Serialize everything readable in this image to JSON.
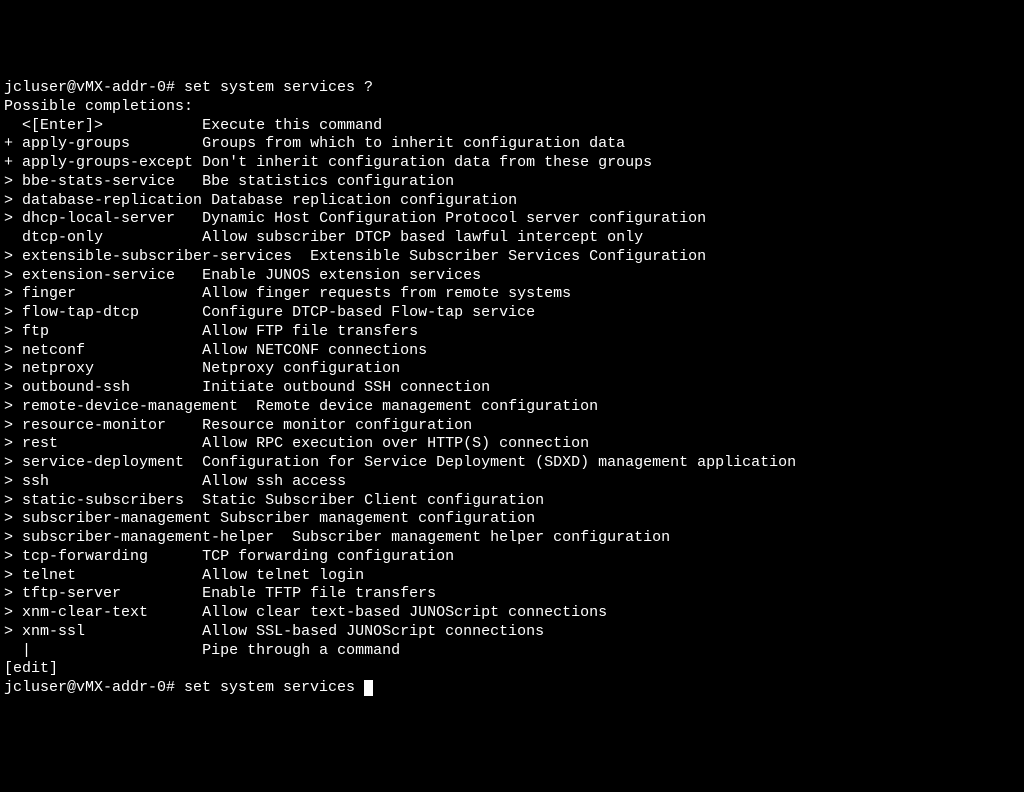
{
  "prompt_user": "jcluser@vMX-addr-0#",
  "prompt_command": "set system services ?",
  "header": "Possible completions:",
  "completions": [
    {
      "marker": " ",
      "cmd": "<[Enter]>",
      "pad": "           ",
      "desc": "Execute this command"
    },
    {
      "marker": "+",
      "cmd": "apply-groups",
      "pad": "        ",
      "desc": "Groups from which to inherit configuration data"
    },
    {
      "marker": "+",
      "cmd": "apply-groups-except",
      "pad": " ",
      "desc": "Don't inherit configuration data from these groups"
    },
    {
      "marker": ">",
      "cmd": "bbe-stats-service",
      "pad": "   ",
      "desc": "Bbe statistics configuration"
    },
    {
      "marker": ">",
      "cmd": "database-replication",
      "pad": " ",
      "desc": "Database replication configuration"
    },
    {
      "marker": ">",
      "cmd": "dhcp-local-server",
      "pad": "   ",
      "desc": "Dynamic Host Configuration Protocol server configuration"
    },
    {
      "marker": " ",
      "cmd": "dtcp-only",
      "pad": "           ",
      "desc": "Allow subscriber DTCP based lawful intercept only"
    },
    {
      "marker": ">",
      "cmd": "extensible-subscriber-services",
      "pad": "  ",
      "desc": "Extensible Subscriber Services Configuration"
    },
    {
      "marker": ">",
      "cmd": "extension-service",
      "pad": "   ",
      "desc": "Enable JUNOS extension services"
    },
    {
      "marker": ">",
      "cmd": "finger",
      "pad": "              ",
      "desc": "Allow finger requests from remote systems"
    },
    {
      "marker": ">",
      "cmd": "flow-tap-dtcp",
      "pad": "       ",
      "desc": "Configure DTCP-based Flow-tap service"
    },
    {
      "marker": ">",
      "cmd": "ftp",
      "pad": "                 ",
      "desc": "Allow FTP file transfers"
    },
    {
      "marker": ">",
      "cmd": "netconf",
      "pad": "             ",
      "desc": "Allow NETCONF connections"
    },
    {
      "marker": ">",
      "cmd": "netproxy",
      "pad": "            ",
      "desc": "Netproxy configuration"
    },
    {
      "marker": ">",
      "cmd": "outbound-ssh",
      "pad": "        ",
      "desc": "Initiate outbound SSH connection"
    },
    {
      "marker": ">",
      "cmd": "remote-device-management",
      "pad": "  ",
      "desc": "Remote device management configuration"
    },
    {
      "marker": ">",
      "cmd": "resource-monitor",
      "pad": "    ",
      "desc": "Resource monitor configuration"
    },
    {
      "marker": ">",
      "cmd": "rest",
      "pad": "                ",
      "desc": "Allow RPC execution over HTTP(S) connection"
    },
    {
      "marker": ">",
      "cmd": "service-deployment",
      "pad": "  ",
      "desc": "Configuration for Service Deployment (SDXD) management application"
    },
    {
      "marker": ">",
      "cmd": "ssh",
      "pad": "                 ",
      "desc": "Allow ssh access"
    },
    {
      "marker": ">",
      "cmd": "static-subscribers",
      "pad": "  ",
      "desc": "Static Subscriber Client configuration"
    },
    {
      "marker": ">",
      "cmd": "subscriber-management",
      "pad": " ",
      "desc": "Subscriber management configuration"
    },
    {
      "marker": ">",
      "cmd": "subscriber-management-helper",
      "pad": "  ",
      "desc": "Subscriber management helper configuration"
    },
    {
      "marker": ">",
      "cmd": "tcp-forwarding",
      "pad": "      ",
      "desc": "TCP forwarding configuration"
    },
    {
      "marker": ">",
      "cmd": "telnet",
      "pad": "              ",
      "desc": "Allow telnet login"
    },
    {
      "marker": ">",
      "cmd": "tftp-server",
      "pad": "         ",
      "desc": "Enable TFTP file transfers"
    },
    {
      "marker": ">",
      "cmd": "xnm-clear-text",
      "pad": "      ",
      "desc": "Allow clear text-based JUNOScript connections"
    },
    {
      "marker": ">",
      "cmd": "xnm-ssl",
      "pad": "             ",
      "desc": "Allow SSL-based JUNOScript connections"
    },
    {
      "marker": " ",
      "cmd": "|",
      "pad": "                   ",
      "desc": "Pipe through a command"
    }
  ],
  "mode": "[edit]",
  "prompt2_user": "jcluser@vMX-addr-0#",
  "prompt2_command": "set system services "
}
